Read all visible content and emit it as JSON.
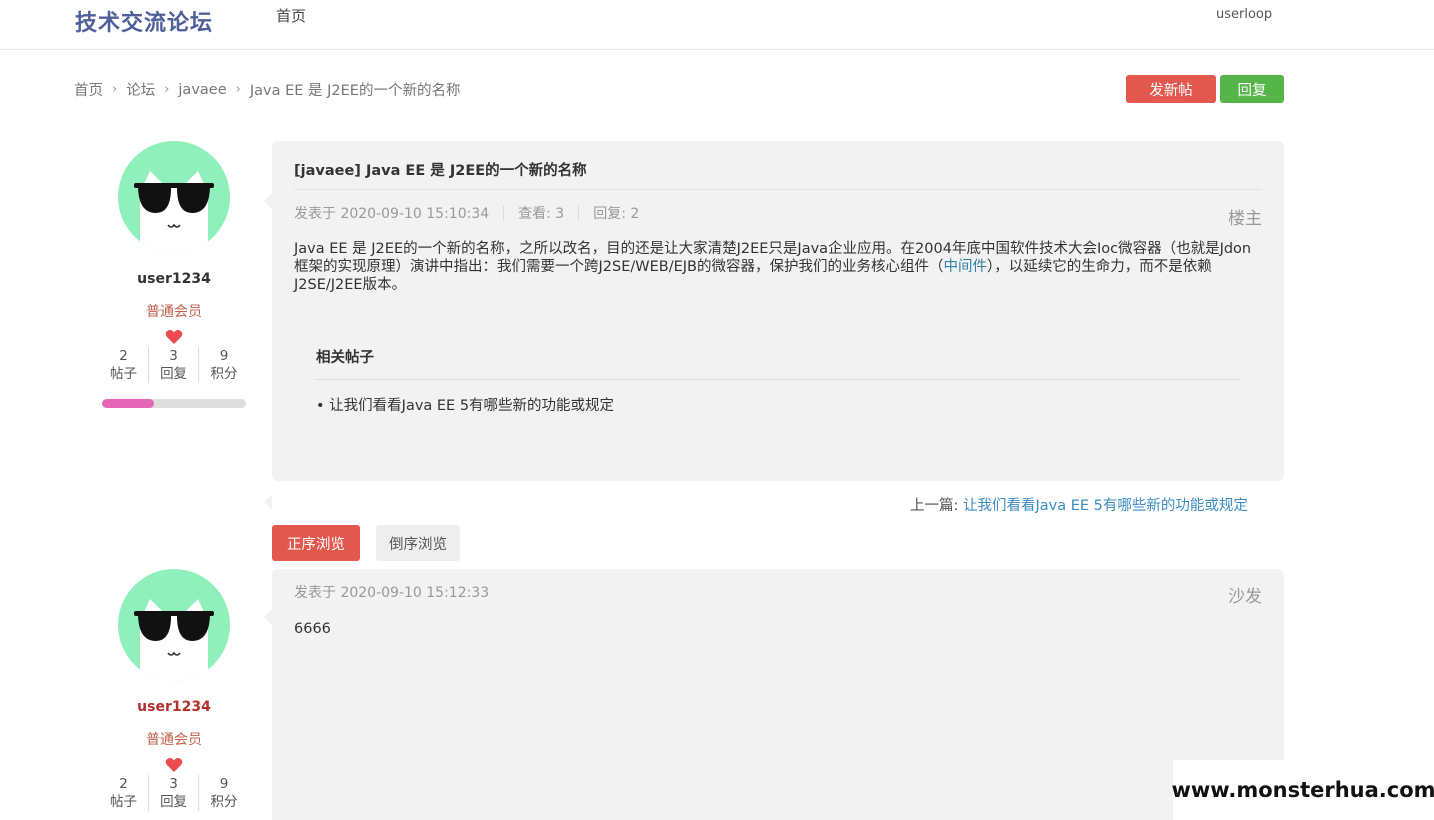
{
  "header": {
    "logo": "技术交流论坛",
    "nav_home": "首页",
    "username": "userloop"
  },
  "breadcrumb": {
    "items": [
      "首页",
      "论坛",
      "javaee",
      "Java EE 是 J2EE的一个新的名称"
    ],
    "separator": "›"
  },
  "actions": {
    "new_post": "发新帖",
    "reply": "回复"
  },
  "colors": {
    "accent_red": "#e2574e",
    "accent_green": "#56b548",
    "avatar_bg": "#8ff0bb",
    "link": "#3b8cc0"
  },
  "posts": [
    {
      "author": {
        "name": "user1234",
        "role": "普通会员",
        "icon": "heart-icon",
        "stats": [
          {
            "value": "2",
            "label": "帖子"
          },
          {
            "value": "3",
            "label": "回复"
          },
          {
            "value": "9",
            "label": "积分"
          }
        ],
        "level_progress": 0.36
      },
      "title": "[javaee] Java EE 是 J2EE的一个新的名称",
      "meta": {
        "posted": "发表于 2020-09-10 15:10:34",
        "views": "查看: 3",
        "replies": "回复: 2"
      },
      "floor": "楼主",
      "body_before_link": "Java EE 是 J2EE的一个新的名称，之所以改名，目的还是让大家清楚J2EE只是Java企业应用。在2004年底中国软件技术大会Ioc微容器（也就是Jdon框架的实现原理）演讲中指出：我们需要一个跨J2SE/WEB/EJB的微容器，保护我们的业务核心组件（",
      "body_link": "中间件",
      "body_after_link": "），以延续它的生命力，而不是依赖J2SE/J2EE版本。",
      "related": {
        "title": "相关帖子",
        "items": [
          "• 让我们看看Java EE 5有哪些新的功能或规定"
        ]
      }
    },
    {
      "author": {
        "name": "user1234",
        "role": "普通会员",
        "icon": "heart-icon",
        "stats": [
          {
            "value": "2",
            "label": "帖子"
          },
          {
            "value": "3",
            "label": "回复"
          },
          {
            "value": "9",
            "label": "积分"
          }
        ]
      },
      "meta": {
        "posted": "发表于 2020-09-10 15:12:33"
      },
      "floor": "沙发",
      "body": "6666"
    }
  ],
  "prev": {
    "label": "上一篇:",
    "link": "让我们看看Java EE 5有哪些新的功能或规定"
  },
  "sort": {
    "asc": "正序浏览",
    "desc": "倒序浏览"
  },
  "watermark": "www.monsterhua.com"
}
